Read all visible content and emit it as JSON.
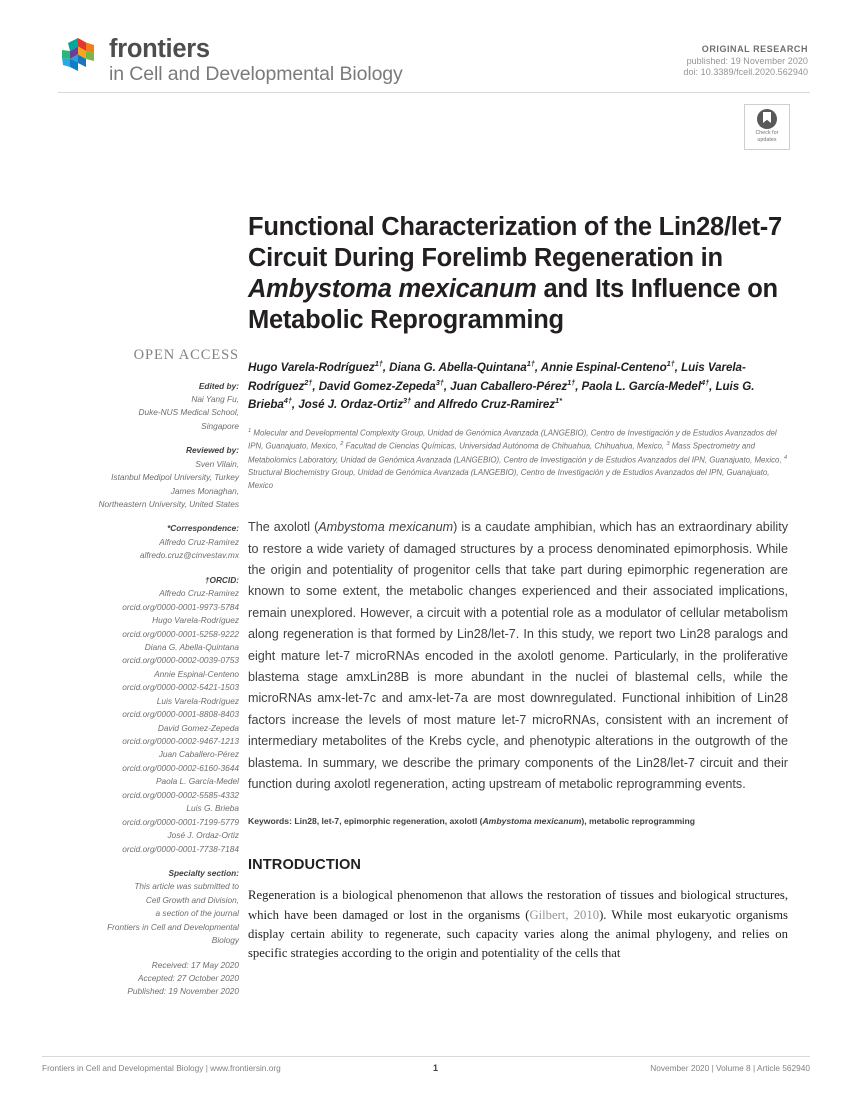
{
  "journal": {
    "logo_name": "frontiers",
    "tagline": "in Cell and Developmental Biology"
  },
  "header": {
    "article_type": "ORIGINAL RESEARCH",
    "published": "published: 19 November 2020",
    "doi": "doi: 10.3389/fcell.2020.562940",
    "crossmark_line1": "Check for",
    "crossmark_line2": "updates"
  },
  "sidebar": {
    "open_access": "OPEN ACCESS",
    "edited_by_label": "Edited by:",
    "edited_by": [
      "Nai Yang Fu,",
      "Duke-NUS Medical School,",
      "Singapore"
    ],
    "reviewed_by_label": "Reviewed by:",
    "reviewed_by": [
      "Sven Vilain,",
      "Istanbul Medipol University, Turkey",
      "James Monaghan,",
      "Northeastern University, United States"
    ],
    "correspondence_label": "*Correspondence:",
    "correspondence": [
      "Alfredo Cruz-Ramirez",
      "alfredo.cruz@cinvestav.mx"
    ],
    "orcid_label": "†ORCID:",
    "orcid": [
      {
        "name": "Alfredo Cruz-Ramirez",
        "id": "orcid.org/0000-0001-9973-5784"
      },
      {
        "name": "Hugo Varela-Rodríguez",
        "id": "orcid.org/0000-0001-5258-9222"
      },
      {
        "name": "Diana G. Abella-Quintana",
        "id": "orcid.org/0000-0002-0039-0753"
      },
      {
        "name": "Annie Espinal-Centeno",
        "id": "orcid.org/0000-0002-5421-1503"
      },
      {
        "name": "Luis Varela-Rodríguez",
        "id": "orcid.org/0000-0001-8808-8403"
      },
      {
        "name": "David Gomez-Zepeda",
        "id": "orcid.org/0000-0002-9467-1213"
      },
      {
        "name": "Juan Caballero-Pérez",
        "id": "orcid.org/0000-0002-6160-3644"
      },
      {
        "name": "Paola L. García-Medel",
        "id": "orcid.org/0000-0002-5585-4332"
      },
      {
        "name": "Luis G. Brieba",
        "id": "orcid.org/0000-0001-7199-5779"
      },
      {
        "name": "José J. Ordaz-Ortiz",
        "id": "orcid.org/0000-0001-7738-7184"
      }
    ],
    "specialty_label": "Specialty section:",
    "specialty": [
      "This article was submitted to",
      "Cell Growth and Division,",
      "a section of the journal",
      "Frontiers in Cell and Developmental",
      "Biology"
    ],
    "received_label": "Received:",
    "received": "17 May 2020",
    "accepted_label": "Accepted:",
    "accepted": "27 October 2020",
    "published_label": "Published:",
    "published": "19 November 2020"
  },
  "article": {
    "title_part1": "Functional Characterization of the Lin28/let-7 Circuit During Forelimb Regeneration in ",
    "title_italic1": "Ambystoma mexicanum",
    "title_part2": " and Its Influence on Metabolic Reprogramming",
    "authors_html": "Hugo Varela-Rodríguez<sup>1†</sup>, Diana G. Abella-Quintana<sup>1†</sup>, Annie Espinal-Centeno<sup>1†</sup>, Luis Varela-Rodríguez<sup>2†</sup>, David Gomez-Zepeda<sup>3†</sup>, Juan Caballero-Pérez<sup>1†</sup>, Paola L. García-Medel<sup>4†</sup>, Luis G. Brieba<sup>4†</sup>, José J. Ordaz-Ortiz<sup>3†</sup> and Alfredo Cruz-Ramirez<sup>1*</sup>",
    "affiliations_html": "<sup>1</sup> Molecular and Developmental Complexity Group, Unidad de Genómica Avanzada (LANGEBIO), Centro de Investigación y de Estudios Avanzados del IPN, Guanajuato, Mexico, <sup>2</sup> Facultad de Ciencias Químicas, Universidad Autónoma de Chihuahua, Chihuahua, Mexico, <sup>3</sup> Mass Spectrometry and Metabolomics Laboratory, Unidad de Genómica Avanzada (LANGEBIO), Centro de Investigación y de Estudios Avanzados del IPN, Guanajuato, Mexico, <sup>4</sup> Structural Biochemistry Group, Unidad de Genómica Avanzada (LANGEBIO), Centro de Investigación y de Estudios Avanzados del IPN, Guanajuato, Mexico",
    "abstract_html": "The axolotl (<em>Ambystoma mexicanum</em>) is a caudate amphibian, which has an extraordinary ability to restore a wide variety of damaged structures by a process denominated epimorphosis. While the origin and potentiality of progenitor cells that take part during epimorphic regeneration are known to some extent, the metabolic changes experienced and their associated implications, remain unexplored. However, a circuit with a potential role as a modulator of cellular metabolism along regeneration is that formed by Lin28/let-7. In this study, we report two Lin28 paralogs and eight mature let-7 microRNAs encoded in the axolotl genome. Particularly, in the proliferative blastema stage amxLin28B is more abundant in the nuclei of blastemal cells, while the microRNAs amx-let-7c and amx-let-7a are most downregulated. Functional inhibition of Lin28 factors increase the levels of most mature let-7 microRNAs, consistent with an increment of intermediary metabolites of the Krebs cycle, and phenotypic alterations in the outgrowth of the blastema. In summary, we describe the primary components of the Lin28/let-7 circuit and their function during axolotl regeneration, acting upstream of metabolic reprogramming events.",
    "keywords_html": "Keywords: Lin28, let-7, epimorphic regeneration, axolotl (<em>Ambystoma mexicanum</em>), metabolic reprogramming",
    "section_heading": "INTRODUCTION",
    "intro_html": "Regeneration is a biological phenomenon that allows the restoration of tissues and biological structures, which have been damaged or lost in the organisms (<span class=\"cite\">Gilbert, 2010</span>). While most eukaryotic organisms display certain ability to regenerate, such capacity varies along the animal phylogeny, and relies on specific strategies according to the origin and potentiality of the cells that"
  },
  "footer": {
    "left": "Frontiers in Cell and Developmental Biology | www.frontiersin.org",
    "page": "1",
    "right": "November 2020 | Volume 8 | Article 562940"
  }
}
